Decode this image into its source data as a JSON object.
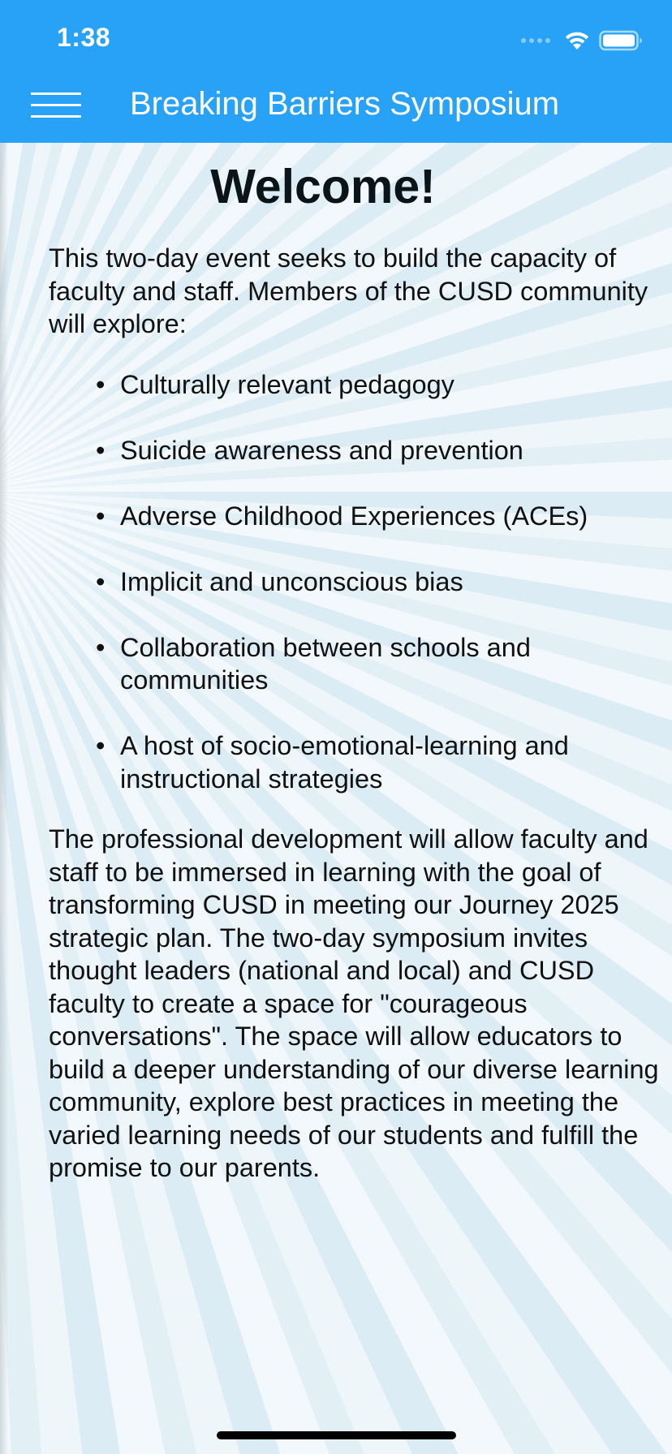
{
  "status_bar": {
    "time": "1:38",
    "icons": [
      "cellular-signal-icon",
      "wifi-icon",
      "battery-icon"
    ]
  },
  "app_bar": {
    "menu_icon": "hamburger-menu-icon",
    "title": "Breaking Barriers Symposium",
    "background_color": "#27a2f7"
  },
  "content": {
    "heading": "Welcome!",
    "intro": "This two-day event seeks to build the capacity of faculty and staff. Members of the CUSD community will explore:",
    "topics": [
      "Culturally relevant pedagogy",
      "Suicide awareness and prevention",
      "Adverse Childhood Experiences (ACEs)",
      "Implicit and unconscious bias",
      "Collaboration between schools and communities",
      "A host of socio-emotional-learning and instructional strategies"
    ],
    "bullet": "•",
    "closing": "The professional development will allow faculty and staff to be immersed in learning with the goal of transforming CUSD in meeting our Journey 2025 strategic plan. The two-day symposium invites thought leaders (national and local) and CUSD faculty to create a space for \"courageous conversations\". The space will allow educators to build a deeper understanding of our diverse learning community, explore best practices in meeting the varied learning needs of our students and fulfill the promise to our parents."
  }
}
